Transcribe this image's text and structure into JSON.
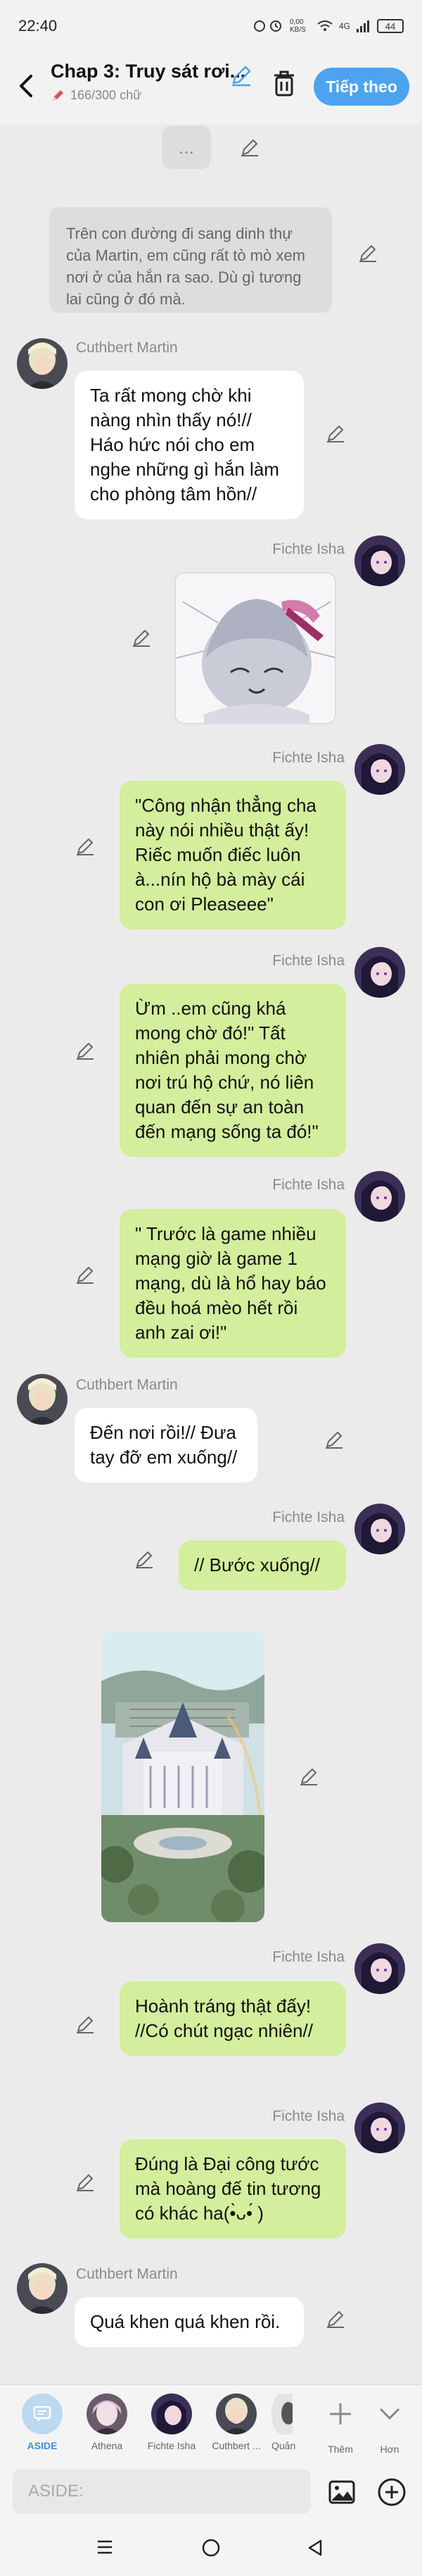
{
  "status_bar": {
    "time": "22:40",
    "speed": "0,00 KB/S",
    "network": "4G",
    "battery": "44"
  },
  "header": {
    "title": "Chap 3: Truy sát rơi...",
    "word_count": "166/300 chữ",
    "follow_label": "Tiếp theo"
  },
  "chat": {
    "ellipsis": "...",
    "narration": "Trên con đường đi sang dinh thự của Martin, em cũng rất tò mò xem nơi ở của hắn ra sao. Dù gì tương lai cũng ở đó mà.",
    "messages": [
      {
        "name": "Cuthbert Martin",
        "text": "Ta rất mong chờ khi nàng nhìn thấy nó!// Háo hức nói cho em nghe những gì hắn làm cho phòng tâm hồn//"
      },
      {
        "name": "Fichte Isha",
        "text": ""
      },
      {
        "name": "Fichte Isha",
        "text": "\"Công nhận thẳng cha này nói nhiều thật ấy! Riếc muốn điếc luôn à...nín hộ bà mày cái con ơi Pleaseee\""
      },
      {
        "name": "Fichte Isha",
        "text": "Ừm ..em cũng khá mong chờ đó!\" Tất nhiên phải mong chờ nơi trú hộ chứ, nó liên quan đến sự an toàn đến mạng sống ta đó!\""
      },
      {
        "name": "Fichte Isha",
        "text": "\" Trước là game nhiều mạng giờ là game 1 mạng, dù là hổ hay báo đều hoá mèo hết rồi anh zai ơi!\""
      },
      {
        "name": "Cuthbert Martin",
        "text": "Đến nơi rồi!// Đưa tay đỡ em xuống//"
      },
      {
        "name": "Fichte Isha",
        "text": "// Bước xuống//"
      },
      {
        "name": "",
        "text": ""
      },
      {
        "name": "Fichte Isha",
        "text": "Hoành tráng thật đấy! //Có chút ngạc nhiên//"
      },
      {
        "name": "Fichte Isha",
        "text": "Đúng là Đại công tước mà hoàng đế tin tương có khác ha(•̀ᴗ•́ )"
      },
      {
        "name": "Cuthbert Martin",
        "text": "Quá khen quá khen rồi."
      }
    ]
  },
  "characters": [
    {
      "label": "ASIDE",
      "icon": "aside-icon"
    },
    {
      "label": "Athena"
    },
    {
      "label": "Fichte Isha"
    },
    {
      "label": "Cuthbert ..."
    },
    {
      "label": "Quản"
    }
  ],
  "tools": [
    {
      "label": "Thêm",
      "icon": "plus-icon"
    },
    {
      "label": "Hơn",
      "icon": "chevron-down-icon"
    }
  ],
  "input": {
    "placeholder": "ASIDE:"
  },
  "colors": {
    "accent": "#4da3ef",
    "user_bubble": "#d3ee9c",
    "other_bubble": "#ffffff",
    "background": "#ebebeb"
  }
}
